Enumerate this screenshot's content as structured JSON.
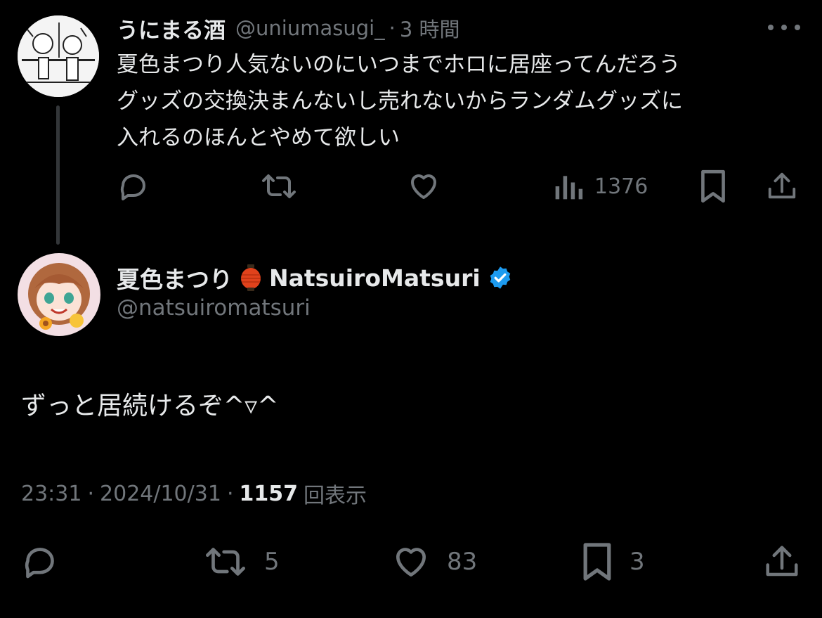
{
  "parent_tweet": {
    "display_name": "うにまる酒",
    "handle": "@uniumasugi_",
    "separator": "·",
    "time_ago": "3 時間",
    "text_lines": [
      "夏色まつり人気ないのにいつまでホロに居座ってんだろう",
      "グッズの交換決まんないし売れないからランダムグッズに",
      "入れるのほんとやめて欲しい"
    ],
    "actions": {
      "reply_icon": "reply-icon",
      "repost_icon": "repost-icon",
      "like_icon": "heart-icon",
      "views_icon": "views-chart-icon",
      "views_count": "1376",
      "bookmark_icon": "bookmark-icon",
      "share_icon": "share-icon"
    }
  },
  "main_tweet": {
    "display_name": "夏色まつり",
    "display_name_en": "NatsuiroMatsuri",
    "handle": "@natsuiromatsuri",
    "text": "ずっと居続けるぞ^▿^",
    "time": "23:31",
    "sep1": "·",
    "date": "2024/10/31",
    "sep2": "·",
    "views_count": "1157",
    "views_label": "回表示",
    "actions": {
      "repost_count": "5",
      "like_count": "83",
      "bookmark_count": "3"
    }
  },
  "colors": {
    "background": "#000000",
    "primary_text": "#e7e9ea",
    "secondary_text": "#71767b",
    "verified_blue": "#1d9bf0",
    "lantern_red": "#e0421c"
  }
}
